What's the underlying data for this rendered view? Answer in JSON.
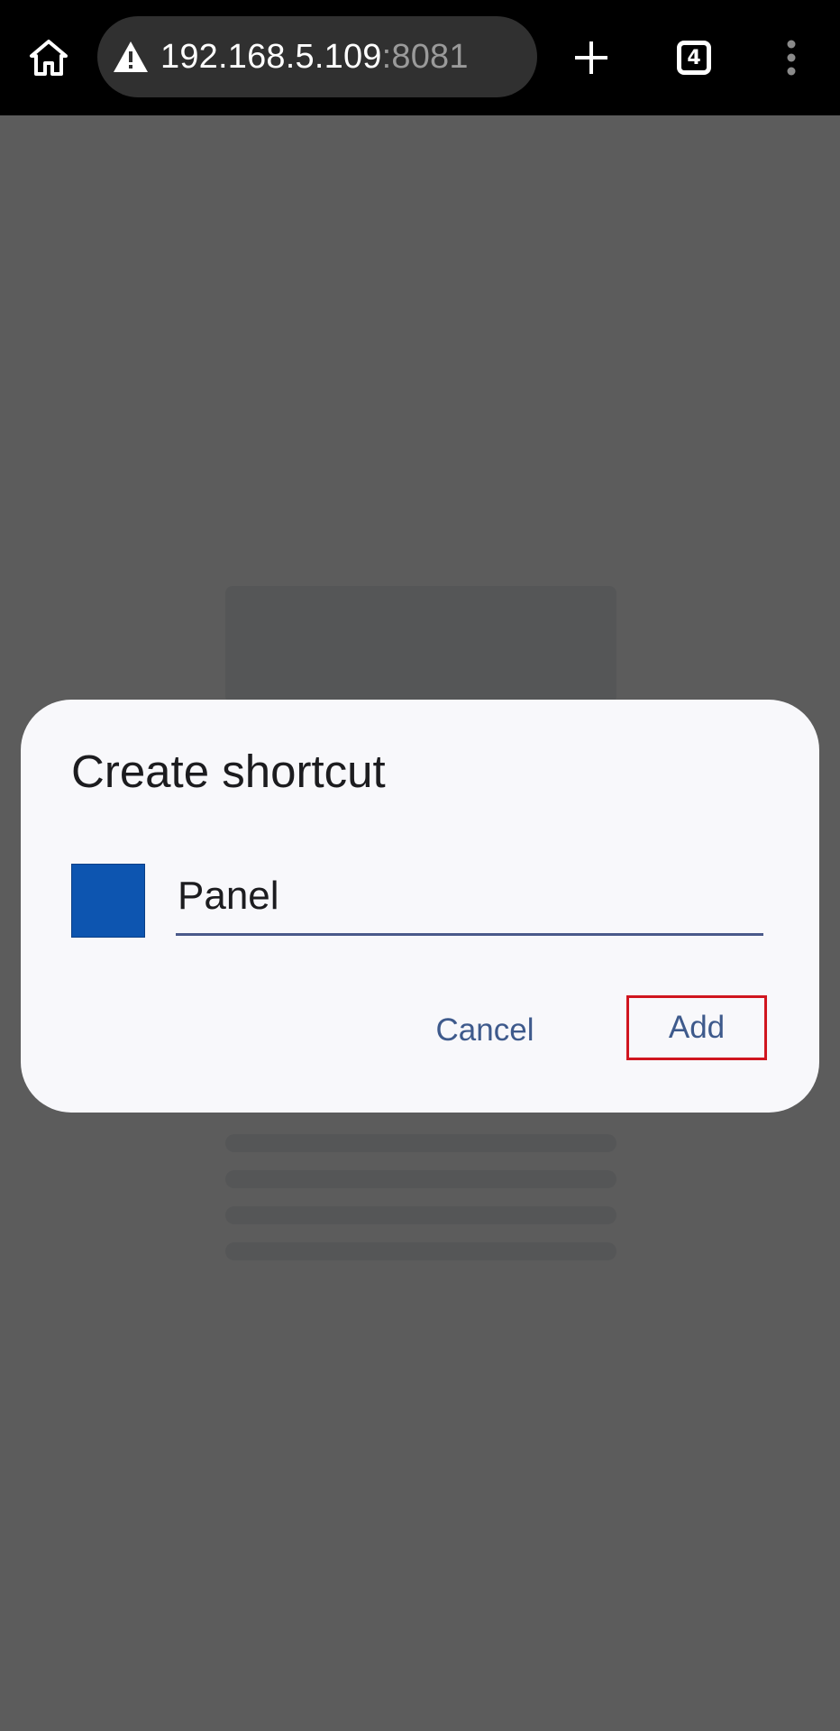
{
  "browser": {
    "url_host": "192.168.5.109",
    "url_port": ":8081",
    "tab_count": "4",
    "icons": {
      "home": "home-icon",
      "security": "warning-icon",
      "new_tab": "plus-icon",
      "tabs": "tab-switcher-icon",
      "menu": "more-vert-icon"
    }
  },
  "dialog": {
    "title": "Create shortcut",
    "shortcut_name": "Panel",
    "cancel_label": "Cancel",
    "add_label": "Add",
    "shortcut_icon_color": "#0d55b0",
    "button_text_color": "#3e5a8c",
    "highlight_color": "#d0151f"
  }
}
